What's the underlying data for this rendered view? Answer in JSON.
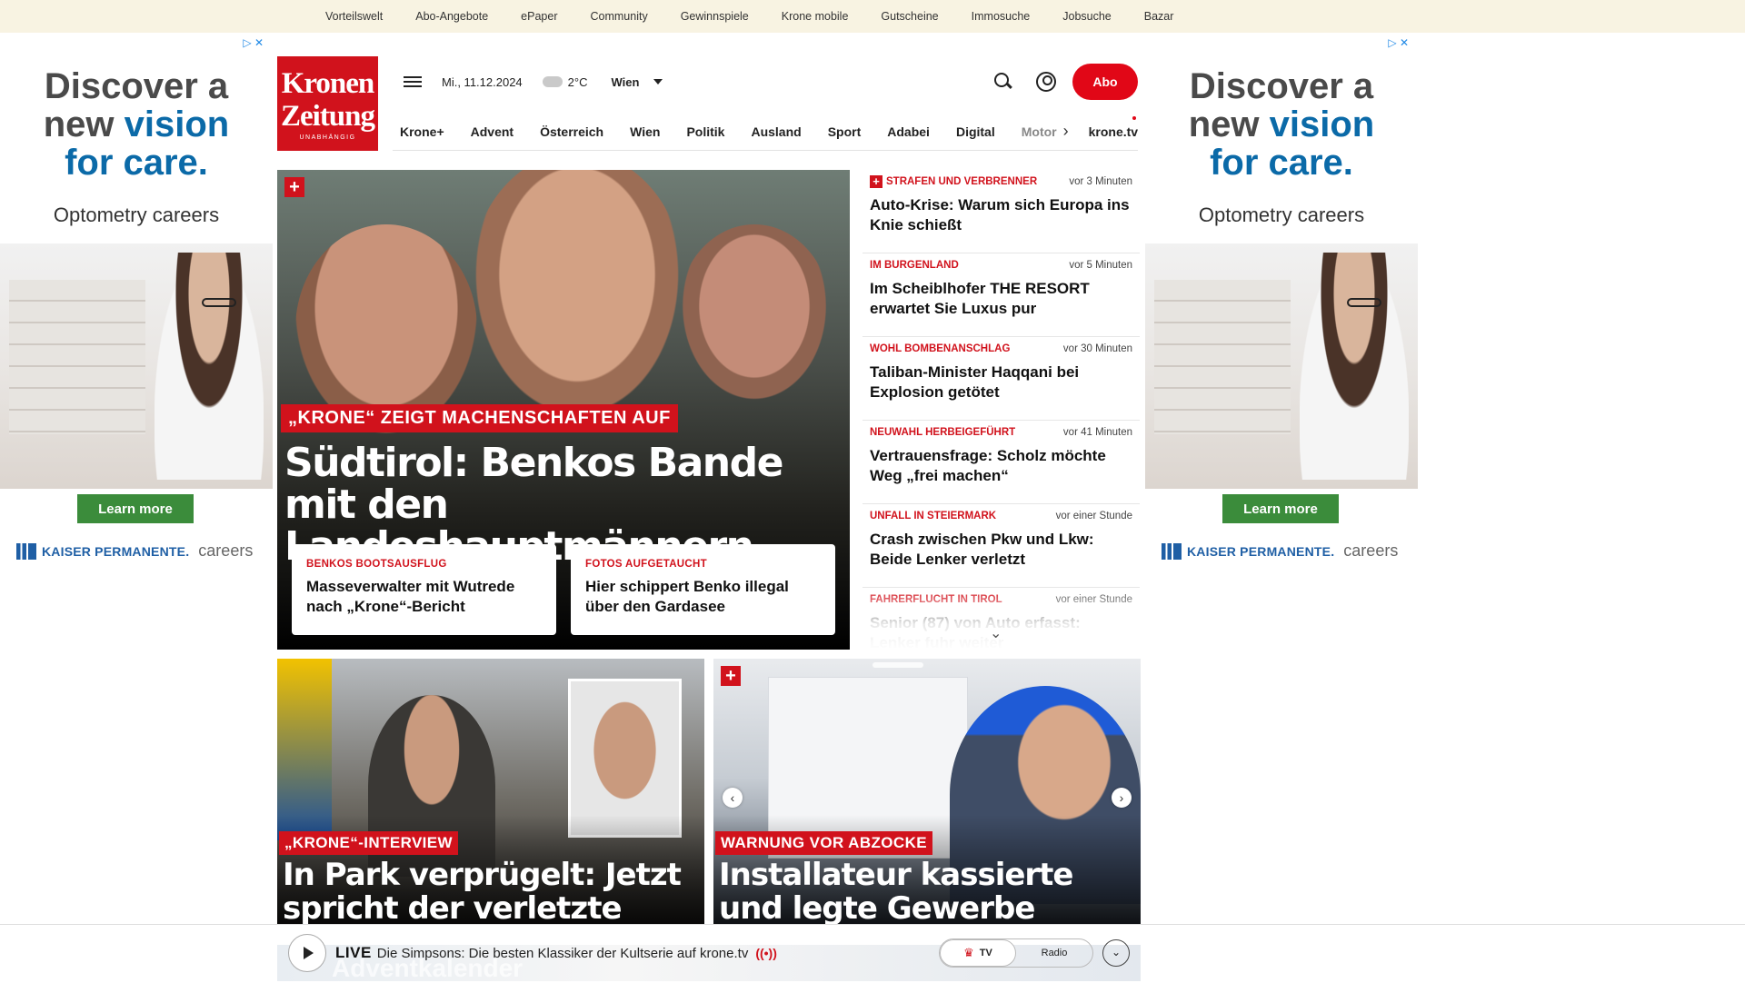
{
  "topnav": [
    "Vorteilswelt",
    "Abo-Angebote",
    "ePaper",
    "Community",
    "Gewinnspiele",
    "Krone mobile",
    "Gutscheine",
    "Immosuche",
    "Jobsuche",
    "Bazar"
  ],
  "ad": {
    "headline_1": "Discover a",
    "headline_2": "new",
    "headline_accent_1": "vision",
    "headline_accent_2": "for care.",
    "sub": "Optometry careers",
    "cta": "Learn more",
    "brand": "KAISER PERMANENTE.",
    "brand_suffix": "careers",
    "corner": "▷ ✕"
  },
  "brand": {
    "line1": "Kronen",
    "line2": "Zeitung",
    "tagline": "UNABHÄNGIG",
    "color": "#d1121c"
  },
  "header": {
    "date": "Mi., 11.12.2024",
    "temperature": "2°C",
    "city": "Wien",
    "abo": "Abo"
  },
  "nav": [
    "Krone+",
    "Advent",
    "Österreich",
    "Wien",
    "Politik",
    "Ausland",
    "Sport",
    "Adabei",
    "Digital",
    "Motor"
  ],
  "nav_tv": "krone.tv",
  "hero": {
    "kicker": "„KRONE“ ZEIGT MACHENSCHAFTEN AUF",
    "title": "Südtirol: Benkos Bande mit den Landeshauptmännern",
    "cards": [
      {
        "kicker": "BENKOS BOOTSAUSFLUG",
        "title": "Masseverwalter mit Wutrede nach „Krone“-Bericht"
      },
      {
        "kicker": "FOTOS AUFGETAUCHT",
        "title": "Hier schippert Benko illegal über den Gardasee"
      }
    ]
  },
  "news": [
    {
      "kicker": "STRAFEN UND VERBRENNER",
      "time": "vor 3 Minuten",
      "title": "Auto-Krise: Warum sich Europa ins Knie schießt",
      "plus": true
    },
    {
      "kicker": "IM BURGENLAND",
      "time": "vor 5 Minuten",
      "title": "Im Scheiblhofer THE RESORT erwartet Sie Luxus pur",
      "plus": false
    },
    {
      "kicker": "WOHL BOMBENANSCHLAG",
      "time": "vor 30 Minuten",
      "title": "Taliban-Minister Haqqani bei Explosion getötet",
      "plus": false
    },
    {
      "kicker": "NEUWAHL HERBEIGEFÜHRT",
      "time": "vor 41 Minuten",
      "title": "Vertrauensfrage: Scholz möchte Weg „frei machen“",
      "plus": false
    },
    {
      "kicker": "UNFALL IN STEIERMARK",
      "time": "vor einer Stunde",
      "title": "Crash zwischen Pkw und Lkw: Beide Lenker verletzt",
      "plus": false
    },
    {
      "kicker": "FAHRERFLUCHT IN TIROL",
      "time": "vor einer Stunde",
      "title": "Senior (87) von Auto erfasst: Lenker fuhr weiter",
      "plus": false
    }
  ],
  "tiles": [
    {
      "kicker": "„KRONE“-INTERVIEW",
      "title": "In Park verprügelt: Jetzt spricht der verletzte Bürgermeister"
    },
    {
      "kicker": "WARNUNG VOR ABZOCKE",
      "title": "Installateur kassierte und legte Gewerbe zurück"
    }
  ],
  "player": {
    "live": "LIVE",
    "text": "Die Simpsons: Die besten Klassiker der Kultserie auf krone.tv",
    "wave": "((•))",
    "tv": "TV",
    "radio": "Radio",
    "strip_text": "Adventkalender"
  }
}
